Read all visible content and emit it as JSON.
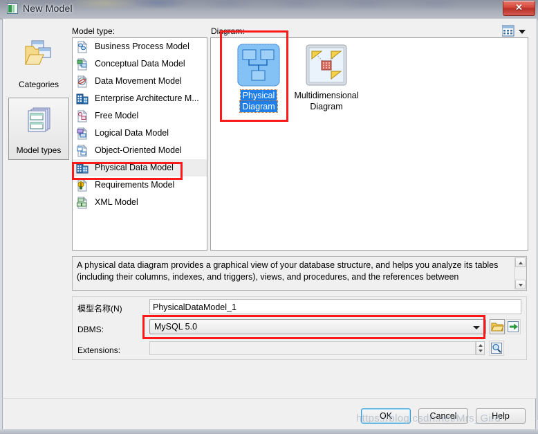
{
  "window": {
    "title": "New Model",
    "icon": "model-window-icon",
    "close_label": "✕"
  },
  "rail": {
    "label": "",
    "items": [
      {
        "label": "Categories",
        "icon": "categories-folder-icon",
        "selected": false
      },
      {
        "label": "Model types",
        "icon": "model-types-stack-icon",
        "selected": true
      }
    ]
  },
  "model_type": {
    "label": "Model type:",
    "items": [
      {
        "label": "Business Process Model",
        "icon": "business-process-model-icon",
        "selected": false
      },
      {
        "label": "Conceptual Data Model",
        "icon": "conceptual-data-model-icon",
        "selected": false
      },
      {
        "label": "Data Movement Model",
        "icon": "data-movement-model-icon",
        "selected": false
      },
      {
        "label": "Enterprise Architecture M...",
        "icon": "enterprise-architecture-model-icon",
        "selected": false
      },
      {
        "label": "Free Model",
        "icon": "free-model-icon",
        "selected": false
      },
      {
        "label": "Logical Data Model",
        "icon": "logical-data-model-icon",
        "selected": false
      },
      {
        "label": "Object-Oriented Model",
        "icon": "object-oriented-model-icon",
        "selected": false
      },
      {
        "label": "Physical Data Model",
        "icon": "physical-data-model-icon",
        "selected": true
      },
      {
        "label": "Requirements Model",
        "icon": "requirements-model-icon",
        "selected": false
      },
      {
        "label": "XML Model",
        "icon": "xml-model-icon",
        "selected": false
      }
    ]
  },
  "diagram": {
    "label": "Diagram:",
    "view_toggle_icon": "details-view-icon",
    "view_toggle_chevron": "chevron-down-icon",
    "items": [
      {
        "label_line1": "Physical",
        "label_line2": "Diagram",
        "icon": "physical-diagram-icon",
        "selected": true
      },
      {
        "label_line1": "Multidimensional",
        "label_line2": "Diagram",
        "icon": "multidimensional-diagram-icon",
        "selected": false
      }
    ]
  },
  "description": {
    "text": "A physical data diagram provides a graphical view of your database structure, and helps you analyze its tables (including their columns, indexes, and triggers), views, and procedures, and the references between"
  },
  "form": {
    "model_name": {
      "label": "模型名称(N)",
      "value": "PhysicalDataModel_1",
      "placeholder": ""
    },
    "dbms": {
      "label": "DBMS:",
      "value": "MySQL 5.0",
      "browse_icon": "folder-open-icon",
      "new_icon": "green-arrow-import-icon"
    },
    "extensions": {
      "label": "Extensions:",
      "value": "",
      "placeholder": "",
      "browse_icon": "magnifier-properties-icon"
    }
  },
  "footer": {
    "ok": "OK",
    "cancel": "Cancel",
    "help": "Help"
  },
  "watermark": "https://blog.csdn.net/Mrs_Gird",
  "colors": {
    "annotation_red": "#fb1a1a",
    "selection_blue": "#1f7fe8",
    "dialog_bg": "#f0f0f0"
  }
}
